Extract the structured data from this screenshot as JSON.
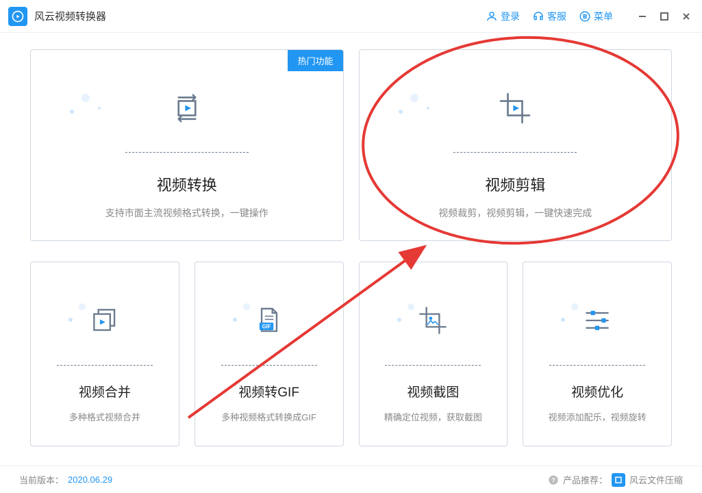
{
  "app": {
    "title": "风云视频转换器"
  },
  "titlebar": {
    "login": "登录",
    "support": "客服",
    "menu": "菜单"
  },
  "cards": {
    "convert": {
      "title": "视频转换",
      "desc": "支持市面主流视频格式转换，一键操作",
      "badge": "热门功能"
    },
    "edit": {
      "title": "视频剪辑",
      "desc": "视频裁剪，视频剪辑，一键快速完成"
    },
    "merge": {
      "title": "视频合并",
      "desc": "多种格式视频合并"
    },
    "gif": {
      "title": "视频转GIF",
      "desc": "多种视频格式转换成GIF",
      "gif_label": "GIF"
    },
    "shot": {
      "title": "视频截图",
      "desc": "精确定位视频，获取截图"
    },
    "optimize": {
      "title": "视频优化",
      "desc": "视频添加配乐，视频旋转"
    }
  },
  "statusbar": {
    "version_label": "当前版本：",
    "version_value": "2020.06.29",
    "recommend_label": "产品推荐：",
    "recommend_name": "风云文件压缩"
  }
}
